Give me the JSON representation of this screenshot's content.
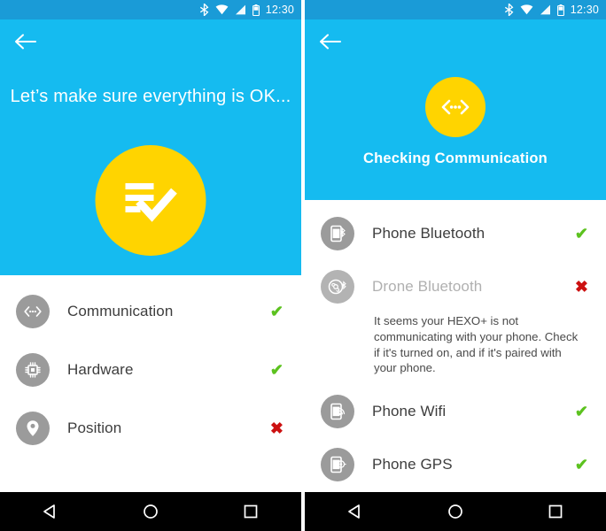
{
  "statusbar": {
    "time": "12:30",
    "icons": [
      "bluetooth-icon",
      "wifi-icon",
      "cellular-signal-icon",
      "battery-icon"
    ]
  },
  "navbar": {
    "back_label": "back-triangle",
    "home_label": "home-circle",
    "recents_label": "recents-square"
  },
  "left_screen": {
    "back_icon": "arrow-left-icon",
    "title": "Let’s make sure everything is OK...",
    "hero_icon": "checklist-check-icon",
    "items": [
      {
        "label": "Communication",
        "icon": "communication-icon",
        "status": "ok",
        "status_glyph": "✔"
      },
      {
        "label": "Hardware",
        "icon": "chip-icon",
        "status": "ok",
        "status_glyph": "✔"
      },
      {
        "label": "Position",
        "icon": "location-pin-icon",
        "status": "bad",
        "status_glyph": "✖"
      }
    ]
  },
  "right_screen": {
    "back_icon": "arrow-left-icon",
    "title": "Checking Communication",
    "hero_icon": "communication-icon",
    "items": [
      {
        "label": "Phone Bluetooth",
        "icon": "phone-bluetooth-icon",
        "status": "ok",
        "status_glyph": "✔",
        "message": ""
      },
      {
        "label": "Drone Bluetooth",
        "icon": "drone-bluetooth-icon",
        "status": "bad",
        "status_glyph": "✖",
        "message": "It seems your HEXO+ is not communicating with your phone. Check if it's turned on, and if it's paired with your phone."
      },
      {
        "label": "Phone Wifi",
        "icon": "phone-wifi-icon",
        "status": "ok",
        "status_glyph": "✔",
        "message": ""
      },
      {
        "label": "Phone GPS",
        "icon": "phone-gps-icon",
        "status": "ok",
        "status_glyph": "✔",
        "message": ""
      }
    ]
  },
  "colors": {
    "hero_blue": "#15bbf0",
    "statusbar_blue": "#1a9bd7",
    "accent_yellow": "#ffd400",
    "icon_grey": "#9b9b9b",
    "status_ok_green": "#5cc21f",
    "status_bad_red": "#cc1111"
  }
}
